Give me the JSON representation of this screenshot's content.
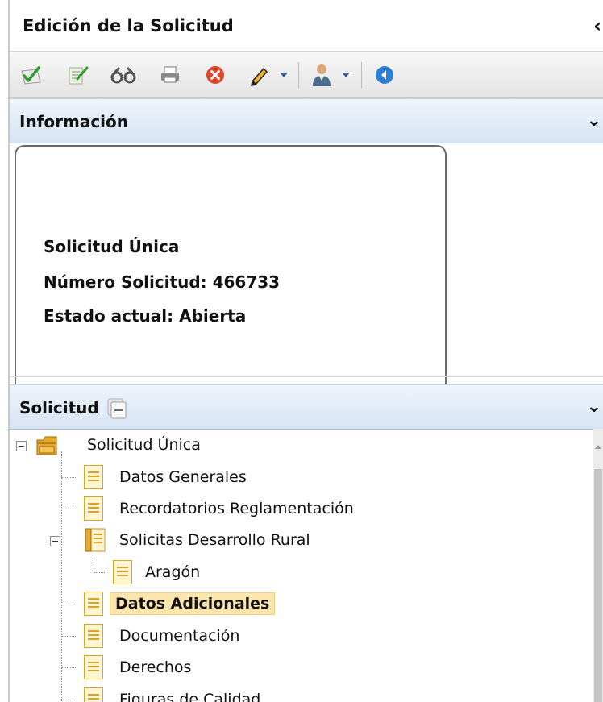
{
  "window": {
    "title": "Edición de la Solicitud",
    "collapse_glyph": "‹"
  },
  "toolbar": {
    "buttons": [
      {
        "icon": "check-document-icon"
      },
      {
        "icon": "edit-document-icon"
      },
      {
        "icon": "search-binoculars-icon"
      },
      {
        "icon": "print-icon"
      },
      {
        "icon": "cancel-icon"
      },
      {
        "icon": "pencil-dropdown-icon"
      },
      {
        "icon": "user-dropdown-icon"
      },
      {
        "icon": "back-icon"
      }
    ]
  },
  "info_panel": {
    "title": "Información",
    "chevron": "⌄",
    "lines": [
      "Solicitud Única",
      "Número Solicitud: 466733",
      "Estado actual: Abierta"
    ]
  },
  "tree_panel": {
    "title": "Solicitud",
    "chevron": "⌄",
    "items": [
      {
        "label": "Solicitud Única",
        "selected": false
      },
      {
        "label": "Datos Generales",
        "selected": false
      },
      {
        "label": "Recordatorios Reglamentación",
        "selected": false
      },
      {
        "label": "Solicitas Desarrollo Rural",
        "selected": false
      },
      {
        "label": "Aragón",
        "selected": false
      },
      {
        "label": "Datos Adicionales",
        "selected": true
      },
      {
        "label": "Documentación",
        "selected": false
      },
      {
        "label": "Derechos",
        "selected": false
      },
      {
        "label": "Figuras de Calidad",
        "selected": false
      }
    ]
  },
  "colors": {
    "header_gradient_top": "#eef4fb",
    "header_gradient_bottom": "#d7e4f3",
    "selected_background": "#fde6ad",
    "folder_color": "#e7a92a"
  }
}
